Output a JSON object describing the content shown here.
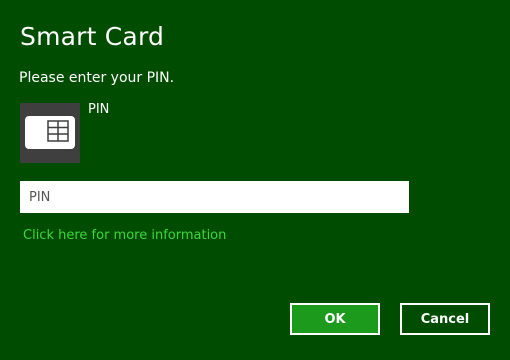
{
  "dialog": {
    "title": "Smart Card",
    "prompt": "Please enter your PIN.",
    "card": {
      "icon": "smart-card-icon",
      "label": "PIN"
    },
    "pin_field": {
      "value": "",
      "placeholder": "PIN"
    },
    "more_info_link": "Click here for more information",
    "buttons": {
      "ok": "OK",
      "cancel": "Cancel"
    }
  },
  "colors": {
    "background": "#004c00",
    "link": "#3dd63d",
    "ok_button": "#1c9a1c",
    "card_tile": "#3f3f3f"
  }
}
